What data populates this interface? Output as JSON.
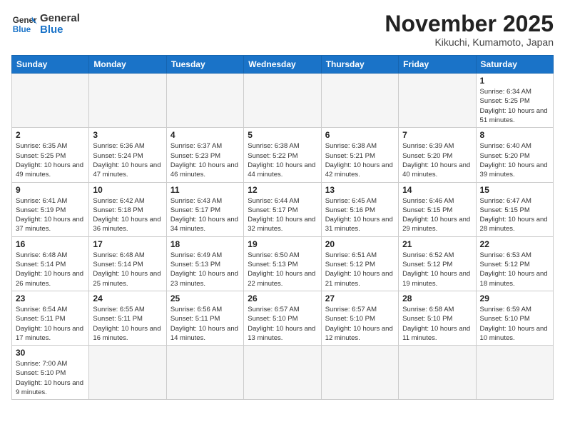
{
  "logo": {
    "text_general": "General",
    "text_blue": "Blue"
  },
  "title": "November 2025",
  "subtitle": "Kikuchi, Kumamoto, Japan",
  "weekdays": [
    "Sunday",
    "Monday",
    "Tuesday",
    "Wednesday",
    "Thursday",
    "Friday",
    "Saturday"
  ],
  "weeks": [
    [
      {
        "day": "",
        "info": ""
      },
      {
        "day": "",
        "info": ""
      },
      {
        "day": "",
        "info": ""
      },
      {
        "day": "",
        "info": ""
      },
      {
        "day": "",
        "info": ""
      },
      {
        "day": "",
        "info": ""
      },
      {
        "day": "1",
        "info": "Sunrise: 6:34 AM\nSunset: 5:25 PM\nDaylight: 10 hours and 51 minutes."
      }
    ],
    [
      {
        "day": "2",
        "info": "Sunrise: 6:35 AM\nSunset: 5:25 PM\nDaylight: 10 hours and 49 minutes."
      },
      {
        "day": "3",
        "info": "Sunrise: 6:36 AM\nSunset: 5:24 PM\nDaylight: 10 hours and 47 minutes."
      },
      {
        "day": "4",
        "info": "Sunrise: 6:37 AM\nSunset: 5:23 PM\nDaylight: 10 hours and 46 minutes."
      },
      {
        "day": "5",
        "info": "Sunrise: 6:38 AM\nSunset: 5:22 PM\nDaylight: 10 hours and 44 minutes."
      },
      {
        "day": "6",
        "info": "Sunrise: 6:38 AM\nSunset: 5:21 PM\nDaylight: 10 hours and 42 minutes."
      },
      {
        "day": "7",
        "info": "Sunrise: 6:39 AM\nSunset: 5:20 PM\nDaylight: 10 hours and 40 minutes."
      },
      {
        "day": "8",
        "info": "Sunrise: 6:40 AM\nSunset: 5:20 PM\nDaylight: 10 hours and 39 minutes."
      }
    ],
    [
      {
        "day": "9",
        "info": "Sunrise: 6:41 AM\nSunset: 5:19 PM\nDaylight: 10 hours and 37 minutes."
      },
      {
        "day": "10",
        "info": "Sunrise: 6:42 AM\nSunset: 5:18 PM\nDaylight: 10 hours and 36 minutes."
      },
      {
        "day": "11",
        "info": "Sunrise: 6:43 AM\nSunset: 5:17 PM\nDaylight: 10 hours and 34 minutes."
      },
      {
        "day": "12",
        "info": "Sunrise: 6:44 AM\nSunset: 5:17 PM\nDaylight: 10 hours and 32 minutes."
      },
      {
        "day": "13",
        "info": "Sunrise: 6:45 AM\nSunset: 5:16 PM\nDaylight: 10 hours and 31 minutes."
      },
      {
        "day": "14",
        "info": "Sunrise: 6:46 AM\nSunset: 5:15 PM\nDaylight: 10 hours and 29 minutes."
      },
      {
        "day": "15",
        "info": "Sunrise: 6:47 AM\nSunset: 5:15 PM\nDaylight: 10 hours and 28 minutes."
      }
    ],
    [
      {
        "day": "16",
        "info": "Sunrise: 6:48 AM\nSunset: 5:14 PM\nDaylight: 10 hours and 26 minutes."
      },
      {
        "day": "17",
        "info": "Sunrise: 6:48 AM\nSunset: 5:14 PM\nDaylight: 10 hours and 25 minutes."
      },
      {
        "day": "18",
        "info": "Sunrise: 6:49 AM\nSunset: 5:13 PM\nDaylight: 10 hours and 23 minutes."
      },
      {
        "day": "19",
        "info": "Sunrise: 6:50 AM\nSunset: 5:13 PM\nDaylight: 10 hours and 22 minutes."
      },
      {
        "day": "20",
        "info": "Sunrise: 6:51 AM\nSunset: 5:12 PM\nDaylight: 10 hours and 21 minutes."
      },
      {
        "day": "21",
        "info": "Sunrise: 6:52 AM\nSunset: 5:12 PM\nDaylight: 10 hours and 19 minutes."
      },
      {
        "day": "22",
        "info": "Sunrise: 6:53 AM\nSunset: 5:12 PM\nDaylight: 10 hours and 18 minutes."
      }
    ],
    [
      {
        "day": "23",
        "info": "Sunrise: 6:54 AM\nSunset: 5:11 PM\nDaylight: 10 hours and 17 minutes."
      },
      {
        "day": "24",
        "info": "Sunrise: 6:55 AM\nSunset: 5:11 PM\nDaylight: 10 hours and 16 minutes."
      },
      {
        "day": "25",
        "info": "Sunrise: 6:56 AM\nSunset: 5:11 PM\nDaylight: 10 hours and 14 minutes."
      },
      {
        "day": "26",
        "info": "Sunrise: 6:57 AM\nSunset: 5:10 PM\nDaylight: 10 hours and 13 minutes."
      },
      {
        "day": "27",
        "info": "Sunrise: 6:57 AM\nSunset: 5:10 PM\nDaylight: 10 hours and 12 minutes."
      },
      {
        "day": "28",
        "info": "Sunrise: 6:58 AM\nSunset: 5:10 PM\nDaylight: 10 hours and 11 minutes."
      },
      {
        "day": "29",
        "info": "Sunrise: 6:59 AM\nSunset: 5:10 PM\nDaylight: 10 hours and 10 minutes."
      }
    ],
    [
      {
        "day": "30",
        "info": "Sunrise: 7:00 AM\nSunset: 5:10 PM\nDaylight: 10 hours and 9 minutes."
      },
      {
        "day": "",
        "info": ""
      },
      {
        "day": "",
        "info": ""
      },
      {
        "day": "",
        "info": ""
      },
      {
        "day": "",
        "info": ""
      },
      {
        "day": "",
        "info": ""
      },
      {
        "day": "",
        "info": ""
      }
    ]
  ]
}
